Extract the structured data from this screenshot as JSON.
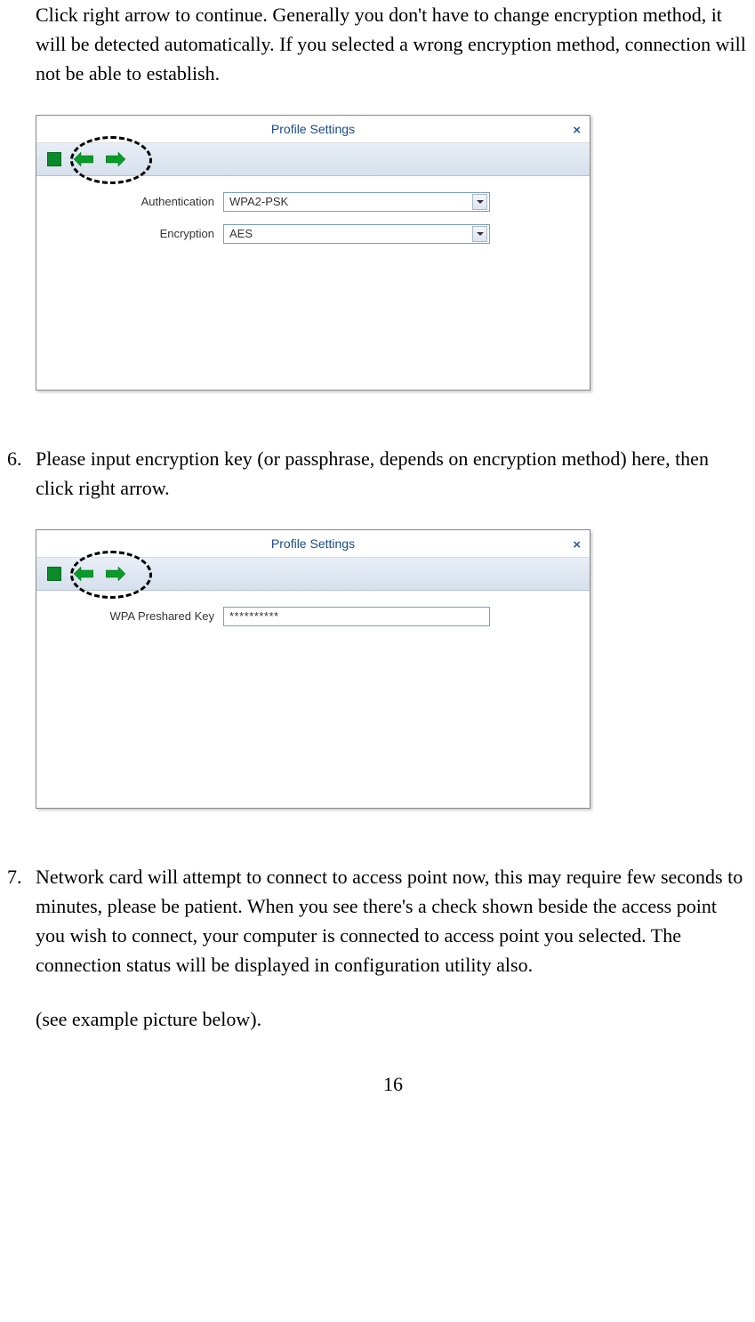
{
  "intro_paragraph": "Click right arrow to continue. Generally you don't have to change encryption method, it will be detected automatically. If you selected a wrong encryption method, connection will not be able to establish.",
  "dialog1": {
    "title": "Profile Settings",
    "close": "×",
    "auth_label": "Authentication",
    "auth_value": "WPA2-PSK",
    "enc_label": "Encryption",
    "enc_value": "AES"
  },
  "step6": {
    "num": "6.",
    "text": "Please input encryption key (or passphrase, depends on encryption method) here, then click right arrow."
  },
  "dialog2": {
    "title": "Profile Settings",
    "close": "×",
    "key_label": "WPA Preshared Key",
    "key_value": "**********"
  },
  "step7": {
    "num": "7.",
    "text": "Network card will attempt to connect to access point now, this may require few seconds to minutes, please be patient. When you see there's a check shown beside the access point you wish to connect, your computer is connected to access point you selected. The connection status will be displayed in configuration utility also.",
    "note": "(see example picture below)."
  },
  "page_number": "16"
}
